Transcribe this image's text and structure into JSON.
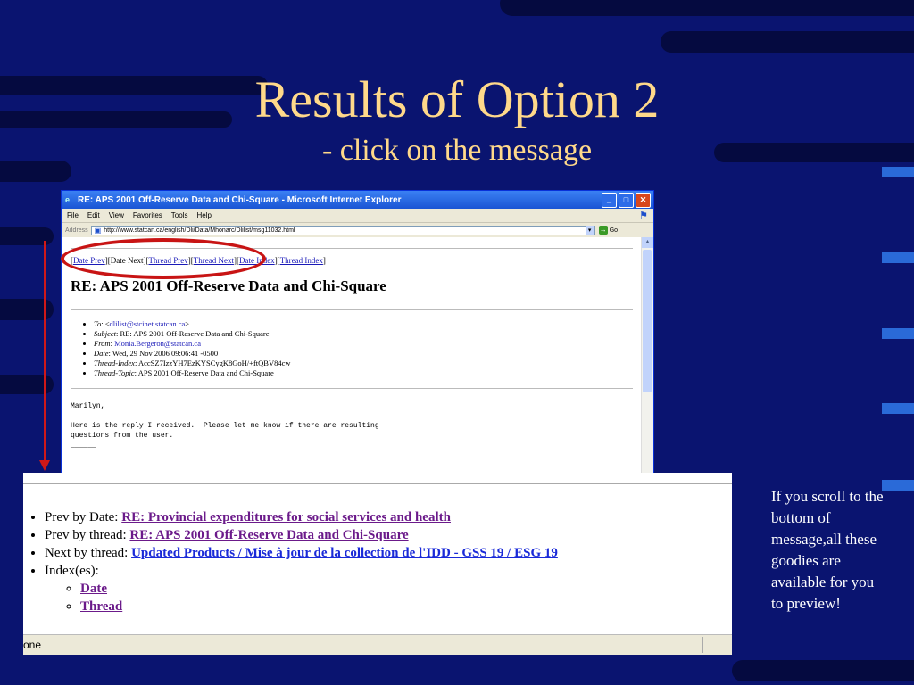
{
  "slide": {
    "title": "Results of Option 2",
    "subtitle": "- click on the message",
    "side_note": "If you scroll to the bottom of message,all these goodies are available for you to preview!"
  },
  "browser": {
    "window_title": "RE: APS 2001 Off-Reserve Data and Chi-Square - Microsoft Internet Explorer",
    "menu": [
      "File",
      "Edit",
      "View",
      "Favorites",
      "Tools",
      "Help"
    ],
    "address_label": "Address",
    "address_value": "http://www.statcan.ca/english/Dli/Data/Mhonarc/Dlilist/msg11032.html",
    "go_label": "Go",
    "status_text": "one"
  },
  "message": {
    "nav": {
      "date_prev": "Date Prev",
      "date_next": "Date Next",
      "thread_prev": "Thread Prev",
      "thread_next": "Thread Next",
      "date_index": "Date Index",
      "thread_index": "Thread Index"
    },
    "heading": "RE: APS 2001 Off-Reserve Data and Chi-Square",
    "headers": [
      {
        "label": "To",
        "value": "<",
        "link": "dlilist@stcinet.statcan.ca",
        "suffix": ">"
      },
      {
        "label": "Subject",
        "value": "RE: APS 2001 Off-Reserve Data and Chi-Square"
      },
      {
        "label": "From",
        "link": "Monia.Bergeron@statcan.ca"
      },
      {
        "label": "Date",
        "value": "Wed, 29 Nov 2006 09:06:41 -0500"
      },
      {
        "label": "Thread-Index",
        "value": "AccSZ7IzzYH7EzKYSCygK8GoH/+ftQBV84cw"
      },
      {
        "label": "Thread-Topic",
        "value": "APS 2001 Off-Reserve Data and Chi-Square"
      }
    ],
    "body": "Marilyn,\n\nHere is the reply I received.  Please let me know if there are resulting\nquestions from the user.\n______"
  },
  "zoom": {
    "prev_date_label": "Prev by Date: ",
    "prev_date_link": "RE: Provincial expenditures for social services and health",
    "prev_thread_label": "Prev by thread: ",
    "prev_thread_link": "RE: APS 2001 Off-Reserve Data and Chi-Square",
    "next_thread_label": "Next by thread: ",
    "next_thread_link": "Updated Products / Mise à jour de la collection de l'IDD - GSS 19 / ESG 19",
    "index_label": "Index(es):",
    "index_date": "Date",
    "index_thread": "Thread"
  },
  "colors": {
    "background": "#0a1470",
    "title": "#ffd98a",
    "annotation": "#c81414"
  }
}
